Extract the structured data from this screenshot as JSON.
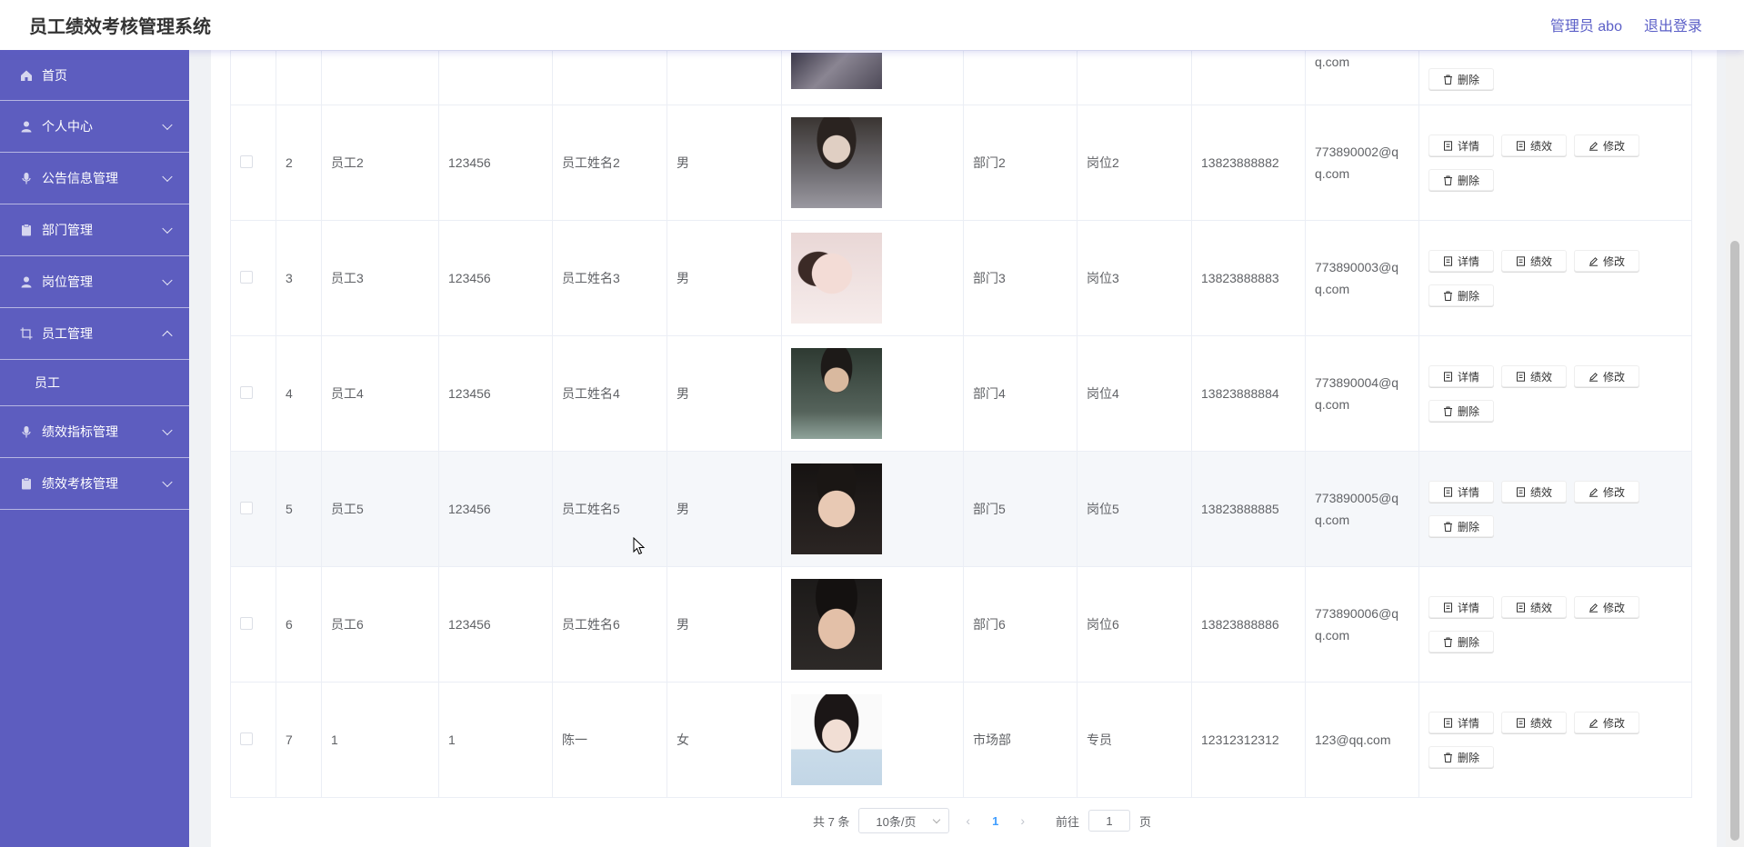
{
  "header": {
    "title": "员工绩效考核管理系统",
    "user_label": "管理员 abo",
    "logout_label": "退出登录"
  },
  "sidebar": {
    "items": [
      {
        "label": "首页",
        "icon": "home-icon"
      },
      {
        "label": "个人中心",
        "icon": "user-icon"
      },
      {
        "label": "公告信息管理",
        "icon": "mic-icon"
      },
      {
        "label": "部门管理",
        "icon": "clipboard-icon"
      },
      {
        "label": "岗位管理",
        "icon": "user-icon"
      },
      {
        "label": "员工管理",
        "icon": "crop-icon"
      },
      {
        "label": "绩效指标管理",
        "icon": "mic-icon"
      },
      {
        "label": "绩效考核管理",
        "icon": "clipboard-icon"
      }
    ],
    "sub_items": [
      {
        "label": "员工"
      }
    ]
  },
  "table": {
    "partial_row": {
      "email_tail": "q.com",
      "delete_label": "删除"
    },
    "rows": [
      {
        "index": "2",
        "account": "员工2",
        "password": "123456",
        "name": "员工姓名2",
        "gender": "男",
        "dept": "部门2",
        "position": "岗位2",
        "phone": "13823888882",
        "email_a": "773890002@q",
        "email_b": "q.com"
      },
      {
        "index": "3",
        "account": "员工3",
        "password": "123456",
        "name": "员工姓名3",
        "gender": "男",
        "dept": "部门3",
        "position": "岗位3",
        "phone": "13823888883",
        "email_a": "773890003@q",
        "email_b": "q.com"
      },
      {
        "index": "4",
        "account": "员工4",
        "password": "123456",
        "name": "员工姓名4",
        "gender": "男",
        "dept": "部门4",
        "position": "岗位4",
        "phone": "13823888884",
        "email_a": "773890004@q",
        "email_b": "q.com"
      },
      {
        "index": "5",
        "account": "员工5",
        "password": "123456",
        "name": "员工姓名5",
        "gender": "男",
        "dept": "部门5",
        "position": "岗位5",
        "phone": "13823888885",
        "email_a": "773890005@q",
        "email_b": "q.com"
      },
      {
        "index": "6",
        "account": "员工6",
        "password": "123456",
        "name": "员工姓名6",
        "gender": "男",
        "dept": "部门6",
        "position": "岗位6",
        "phone": "13823888886",
        "email_a": "773890006@q",
        "email_b": "q.com"
      },
      {
        "index": "7",
        "account": "1",
        "password": "1",
        "name": "陈一",
        "gender": "女",
        "dept": "市场部",
        "position": "专员",
        "phone": "12312312312",
        "email_a": "123@qq.com",
        "email_b": ""
      }
    ],
    "actions": {
      "detail": "详情",
      "performance": "绩效",
      "edit": "修改",
      "delete": "删除"
    }
  },
  "pagination": {
    "total_label": "共 7 条",
    "page_size": "10条/页",
    "current_page": "1",
    "goto_prefix": "前往",
    "goto_value": "1",
    "goto_suffix": "页"
  },
  "colors": {
    "sidebar_bg": "#5d5dbf",
    "accent": "#5b5fc7",
    "page_active": "#409eff"
  }
}
